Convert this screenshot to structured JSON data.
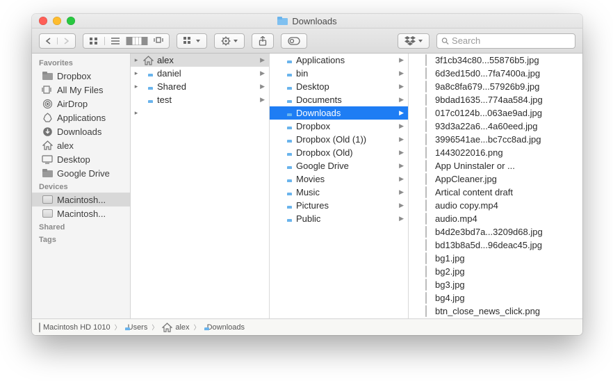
{
  "window": {
    "title": "Downloads"
  },
  "search": {
    "placeholder": "Search"
  },
  "sidebar": {
    "sections": [
      {
        "header": "Favorites",
        "items": [
          {
            "icon": "folder-gray",
            "label": "Dropbox"
          },
          {
            "icon": "all-files",
            "label": "All My Files"
          },
          {
            "icon": "airdrop",
            "label": "AirDrop"
          },
          {
            "icon": "apps",
            "label": "Applications"
          },
          {
            "icon": "download",
            "label": "Downloads"
          },
          {
            "icon": "home",
            "label": "alex"
          },
          {
            "icon": "desktop",
            "label": "Desktop"
          },
          {
            "icon": "folder-gray",
            "label": "Google Drive"
          }
        ]
      },
      {
        "header": "Devices",
        "items": [
          {
            "icon": "hdd",
            "label": "Macintosh...",
            "selected": true
          },
          {
            "icon": "hdd",
            "label": "Macintosh..."
          }
        ]
      },
      {
        "header": "Shared",
        "items": []
      },
      {
        "header": "Tags",
        "items": []
      }
    ]
  },
  "columns": [
    {
      "items": [
        {
          "icon": "home",
          "label": "alex",
          "hasChildren": true,
          "selected": "gray",
          "disclosure": true
        },
        {
          "icon": "folder",
          "label": "daniel",
          "hasChildren": true,
          "disclosure": true
        },
        {
          "icon": "folder",
          "label": "Shared",
          "hasChildren": true,
          "disclosure": true
        },
        {
          "icon": "folder",
          "label": "test",
          "hasChildren": true
        }
      ],
      "overflow": true
    },
    {
      "items": [
        {
          "icon": "folder",
          "label": "Applications",
          "hasChildren": true
        },
        {
          "icon": "folder",
          "label": "bin",
          "hasChildren": true
        },
        {
          "icon": "folder",
          "label": "Desktop",
          "hasChildren": true
        },
        {
          "icon": "folder",
          "label": "Documents",
          "hasChildren": true
        },
        {
          "icon": "folder",
          "label": "Downloads",
          "hasChildren": true,
          "selected": "blue"
        },
        {
          "icon": "folder",
          "label": "Dropbox",
          "hasChildren": true
        },
        {
          "icon": "folder",
          "label": "Dropbox (Old (1))",
          "hasChildren": true
        },
        {
          "icon": "folder",
          "label": "Dropbox (Old)",
          "hasChildren": true
        },
        {
          "icon": "folder",
          "label": "Google Drive",
          "hasChildren": true
        },
        {
          "icon": "folder",
          "label": "Movies",
          "hasChildren": true
        },
        {
          "icon": "folder",
          "label": "Music",
          "hasChildren": true
        },
        {
          "icon": "folder",
          "label": "Pictures",
          "hasChildren": true
        },
        {
          "icon": "folder",
          "label": "Public",
          "hasChildren": true
        }
      ]
    },
    {
      "items": [
        {
          "icon": "image",
          "label": "3f1cb34c80...55876b5.jpg"
        },
        {
          "icon": "image",
          "label": "6d3ed15d0...7fa7400a.jpg"
        },
        {
          "icon": "image",
          "label": "9a8c8fa679...57926b9.jpg"
        },
        {
          "icon": "image",
          "label": "9bdad1635...774aa584.jpg"
        },
        {
          "icon": "image",
          "label": "017c0124b...063ae9ad.jpg"
        },
        {
          "icon": "image",
          "label": "93d3a22a6...4a60eed.jpg"
        },
        {
          "icon": "image",
          "label": "3996541ae...bc7cc8ad.jpg"
        },
        {
          "icon": "image",
          "label": "1443022016.png"
        },
        {
          "icon": "doc",
          "label": "App Uninstaler or ..."
        },
        {
          "icon": "image",
          "label": "AppCleaner.jpg"
        },
        {
          "icon": "doc",
          "label": "Artical content draft"
        },
        {
          "icon": "media",
          "label": "audio copy.mp4"
        },
        {
          "icon": "media",
          "label": "audio.mp4"
        },
        {
          "icon": "image",
          "label": "b4d2e3bd7a...3209d68.jpg"
        },
        {
          "icon": "image",
          "label": "bd13b8a5d...96deac45.jpg"
        },
        {
          "icon": "image",
          "label": "bg1.jpg"
        },
        {
          "icon": "image",
          "label": "bg2.jpg"
        },
        {
          "icon": "image",
          "label": "bg3.jpg"
        },
        {
          "icon": "image",
          "label": "bg4.jpg"
        },
        {
          "icon": "image",
          "label": "btn_close_news_click.png"
        }
      ]
    }
  ],
  "pathbar": [
    {
      "icon": "hdd",
      "label": "Macintosh HD 1010"
    },
    {
      "icon": "folder",
      "label": "Users"
    },
    {
      "icon": "home",
      "label": "alex"
    },
    {
      "icon": "folder",
      "label": "Downloads"
    }
  ]
}
